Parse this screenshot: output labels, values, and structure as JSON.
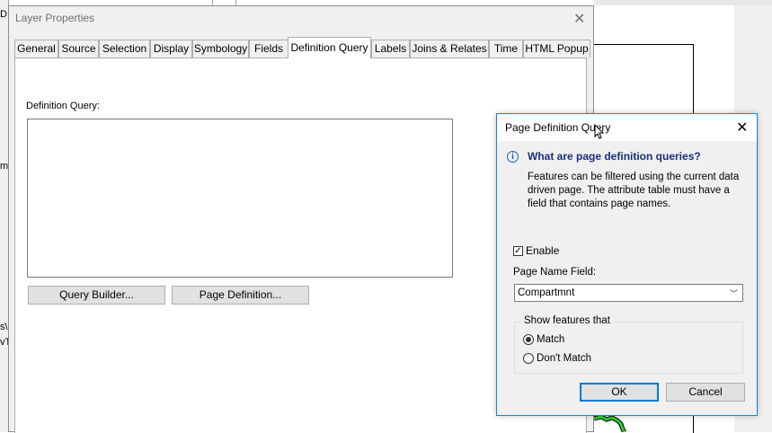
{
  "background": {
    "left_fragments": [
      "D",
      "m",
      "s\\",
      "vT"
    ]
  },
  "layer_properties": {
    "title": "Layer Properties",
    "tabs": [
      {
        "label": "General"
      },
      {
        "label": "Source"
      },
      {
        "label": "Selection"
      },
      {
        "label": "Display"
      },
      {
        "label": "Symbology"
      },
      {
        "label": "Fields"
      },
      {
        "label": "Definition Query"
      },
      {
        "label": "Labels"
      },
      {
        "label": "Joins & Relates"
      },
      {
        "label": "Time"
      },
      {
        "label": "HTML Popup"
      }
    ],
    "active_tab": "Definition Query",
    "definition_query_label": "Definition Query:",
    "definition_query_value": "",
    "query_builder_label": "Query Builder...",
    "page_definition_label": "Page Definition..."
  },
  "page_definition_dialog": {
    "title": "Page Definition Query",
    "info_heading": "What are page definition queries?",
    "info_body": "Features can be filtered using the current data driven page.  The attribute table must have a field that contains page names.",
    "enable_label": "Enable",
    "enable_checked": true,
    "page_name_field_label": "Page Name Field:",
    "page_name_field_value": "Compartmnt",
    "show_features_legend": "Show features that",
    "options": [
      {
        "label": "Match",
        "checked": true
      },
      {
        "label": "Don't Match",
        "checked": false
      }
    ],
    "ok_label": "OK",
    "cancel_label": "Cancel"
  },
  "colors": {
    "accent": "#0078d7",
    "info_heading": "#1a2f7a",
    "map_line": "#33cc33"
  }
}
